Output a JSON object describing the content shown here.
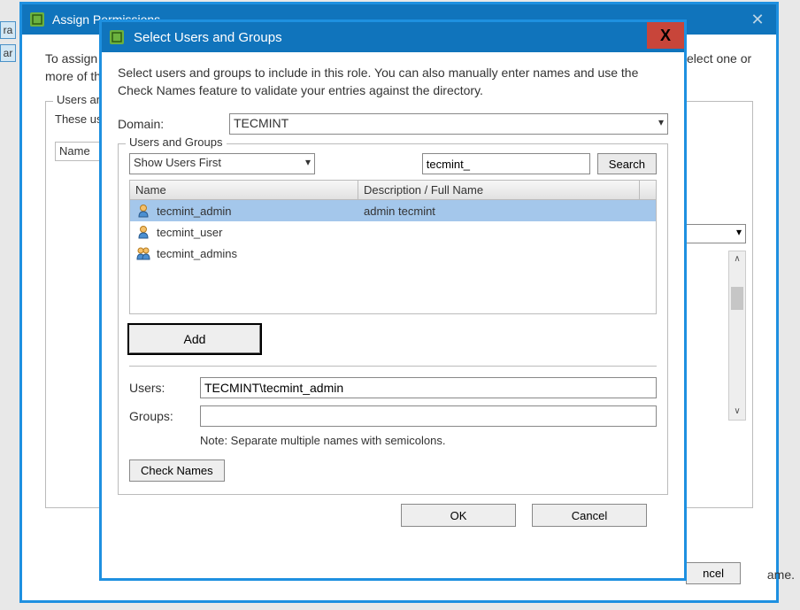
{
  "bg_tabs": {
    "a": "ra",
    "b": "ar"
  },
  "parent_dialog": {
    "title": "Assign Permissions",
    "body_text": "To assign a permission to an individual or group of users, add their names to the Users and Groups list below. Then select one or more of the names and assign a role.",
    "fieldset_label": "Users and Groups",
    "fieldset_desc": "These users and groups can interact with the current object according to the selected role.",
    "name_col": "Name",
    "cancel": "ncel",
    "scroll_up": "∧",
    "scroll_down": "∨"
  },
  "bg_right_text": "ame.",
  "child_dialog": {
    "title": "Select Users and Groups",
    "close_x": "X",
    "desc": "Select users and groups to include in this role. You can also manually enter names and use the Check Names feature to validate your entries against the directory.",
    "domain_label": "Domain:",
    "domain_value": "TECMINT",
    "users_groups_legend": "Users and Groups",
    "show_select": "Show Users First",
    "search_value": "tecmint_",
    "search_btn": "Search",
    "col_name": "Name",
    "col_desc": "Description / Full Name",
    "rows": [
      {
        "type": "user",
        "name": "tecmint_admin",
        "desc": "admin tecmint",
        "selected": true
      },
      {
        "type": "user",
        "name": "tecmint_user",
        "desc": "",
        "selected": false
      },
      {
        "type": "group",
        "name": "tecmint_admins",
        "desc": "",
        "selected": false
      }
    ],
    "add_btn": "Add",
    "users_label": "Users:",
    "users_value": "TECMINT\\tecmint_admin",
    "groups_label": "Groups:",
    "groups_value": "",
    "note": "Note: Separate multiple names with semicolons.",
    "check_names": "Check Names",
    "ok": "OK",
    "cancel": "Cancel"
  }
}
